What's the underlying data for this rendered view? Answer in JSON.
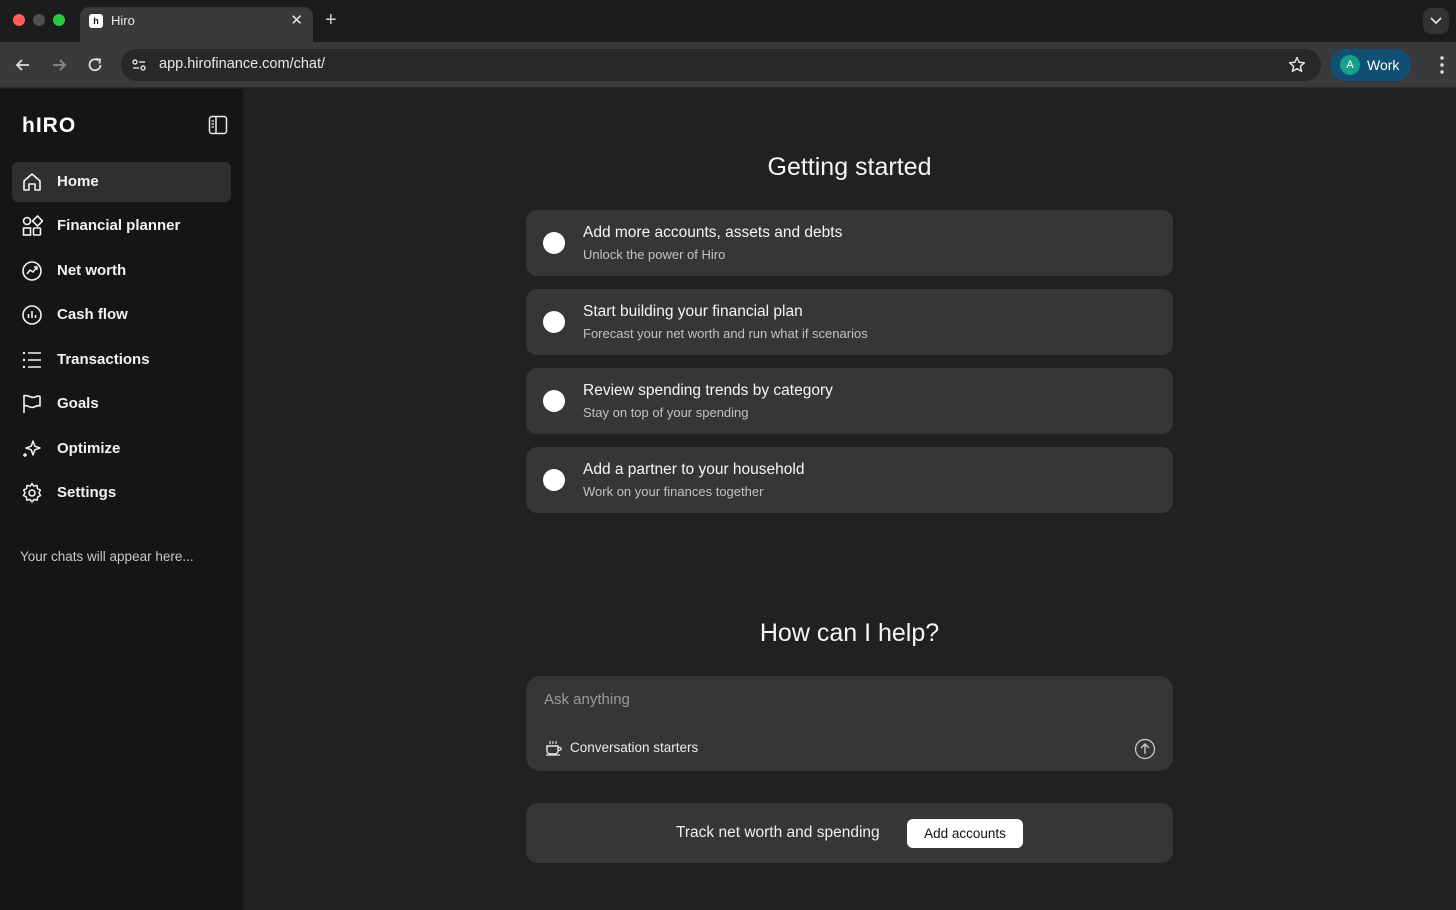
{
  "browser": {
    "tab_title": "Hiro",
    "tab_favicon": "h",
    "url": "app.hirofinance.com/chat/",
    "profile_initial": "A",
    "profile_label": "Work"
  },
  "sidebar": {
    "logo": "hIRO",
    "items": [
      {
        "label": "Home",
        "icon": "home-icon",
        "active": true
      },
      {
        "label": "Financial planner",
        "icon": "grid-icon"
      },
      {
        "label": "Net worth",
        "icon": "trend-icon"
      },
      {
        "label": "Cash flow",
        "icon": "bar-chart-icon"
      },
      {
        "label": "Transactions",
        "icon": "list-icon"
      },
      {
        "label": "Goals",
        "icon": "flag-icon"
      },
      {
        "label": "Optimize",
        "icon": "sparkle-icon"
      },
      {
        "label": "Settings",
        "icon": "gear-icon"
      }
    ],
    "chats_hint": "Your chats will appear here..."
  },
  "main": {
    "getting_started_title": "Getting started",
    "tasks": [
      {
        "title": "Add more accounts, assets and debts",
        "subtitle": "Unlock the power of Hiro"
      },
      {
        "title": "Start building your financial plan",
        "subtitle": "Forecast your net worth and run what if scenarios"
      },
      {
        "title": "Review spending trends by category",
        "subtitle": "Stay on top of your spending"
      },
      {
        "title": "Add a partner to your household",
        "subtitle": "Work on your finances together"
      }
    ],
    "help_title": "How can I help?",
    "chat": {
      "placeholder": "Ask anything",
      "starters_label": "Conversation starters"
    },
    "cta": {
      "text": "Track net worth and spending",
      "button": "Add accounts"
    }
  },
  "colors": {
    "background": "#212121",
    "sidebar": "#151515",
    "card": "#363636",
    "profile_chip": "#0f5073"
  }
}
